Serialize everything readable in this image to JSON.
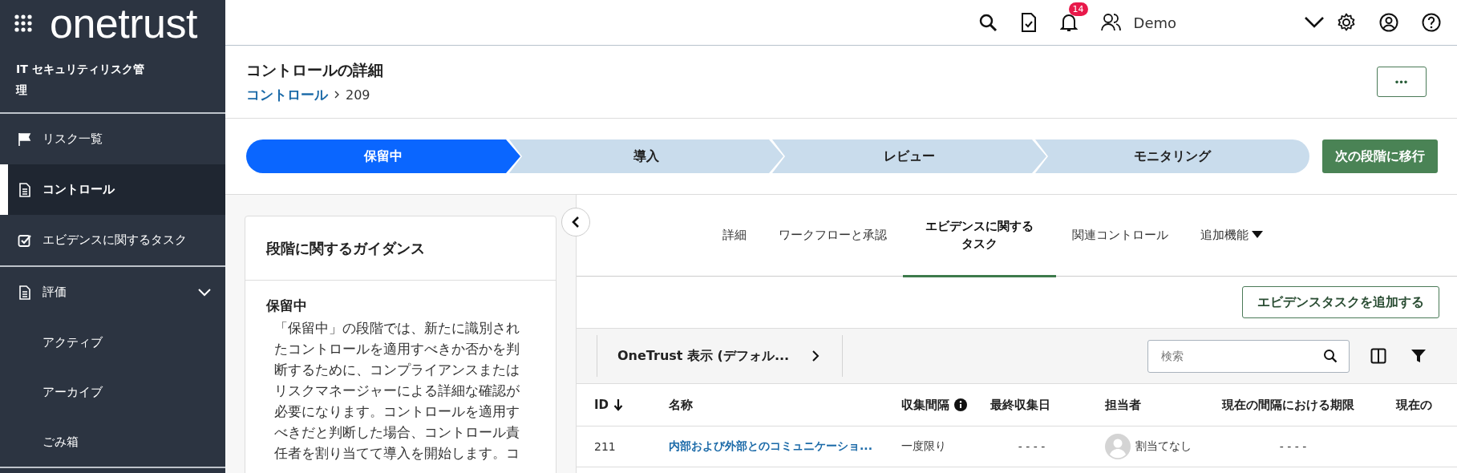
{
  "logo": {
    "text": "onetrust"
  },
  "topbar": {
    "notification_count": "14",
    "user_name": "Demo"
  },
  "sidebar": {
    "module_title": "IT セキュリティリスク管理",
    "items": [
      {
        "label": "リスク一覧",
        "kind": "flag",
        "selected": false
      },
      {
        "label": "コントロール",
        "kind": "document",
        "selected": true
      },
      {
        "label": "エビデンスに関するタスク",
        "kind": "check",
        "selected": false
      },
      {
        "label": "評価",
        "kind": "document",
        "selected": false,
        "expanded": true,
        "children": [
          {
            "label": "アクティブ",
            "selected": false
          },
          {
            "label": "アーカイブ",
            "selected": false
          },
          {
            "label": "ごみ箱",
            "selected": false
          }
        ]
      }
    ]
  },
  "header": {
    "title": "コントロールの詳細",
    "breadcrumb": [
      {
        "label": "コントロール",
        "kind": "link"
      },
      {
        "label": "209",
        "kind": "current"
      }
    ],
    "more_button": "•••"
  },
  "stages": [
    {
      "label": "保留中",
      "selected": true
    },
    {
      "label": "導入",
      "selected": false
    },
    {
      "label": "レビュー",
      "selected": false
    },
    {
      "label": "モニタリング",
      "selected": false
    }
  ],
  "next_stage_button": "次の段階に移行",
  "guidance": {
    "title": "段階に関するガイダンス",
    "stage": "保留中",
    "text": "「保留中」の段階では、新たに識別されたコントロールを適用すべきか否かを判断するために、コンプライアンスまたはリスクマネージャーによる詳細な確認が必要になります。コントロールを適用すべきだと判断した場合、コントロール責任者を割り当てて導入を開始します。コ"
  },
  "tabs": [
    {
      "label": "詳細",
      "selected": false
    },
    {
      "label": "ワークフローと承認",
      "selected": false
    },
    {
      "label": "エビデンスに関するタスク",
      "selected": true
    },
    {
      "label": "関連コントロール",
      "selected": false
    },
    {
      "label": "追加機能",
      "kind": "dropdown",
      "selected": false
    }
  ],
  "add_button": "エビデンスタスクを追加する",
  "view_selector": "OneTrust 表示 (デフォル...",
  "search": {
    "placeholder": "検索"
  },
  "table": {
    "columns": [
      {
        "label": "ID",
        "sorted_descending": true
      },
      {
        "label": "名称"
      },
      {
        "label": "収集間隔",
        "info": true
      },
      {
        "label": "最終収集日"
      },
      {
        "label": "担当者"
      },
      {
        "label": "現在の間隔における期限"
      },
      {
        "label": "現在の"
      }
    ],
    "rows": [
      {
        "id": "211",
        "name": "内部および外部とのコミュニケーショ...",
        "interval": "一度限り",
        "last_collected": "- - - -",
        "assignee": "割当てなし",
        "due": "- - - -"
      }
    ]
  }
}
